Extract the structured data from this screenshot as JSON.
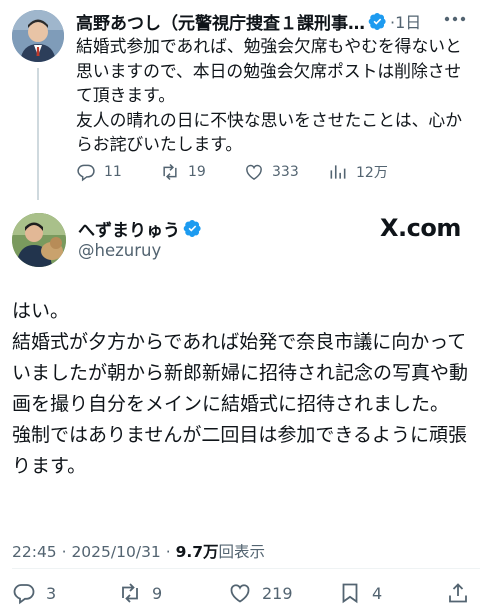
{
  "parent_tweet": {
    "name": "高野あつし（元警視庁捜査１課刑事…",
    "time": "·1日",
    "paragraphs": [
      "結婚式参加であれば、勉強会欠席もやむを得ないと思いますので、本日の勉強会欠席ポストは削除させて頂きます。",
      "友人の晴れの日に不快な思いをさせたことは、心からお詫びいたします。"
    ],
    "actions": {
      "replies": "11",
      "reposts": "19",
      "likes": "333",
      "views": "12万"
    }
  },
  "main_tweet": {
    "name": "へずまりゅう",
    "handle": "@hezuruy",
    "watermark": "X.com",
    "paragraphs": [
      "はい。",
      "結婚式が夕方からであれば始発で奈良市議に向かっていましたが朝から新郎新婦に招待され記念の写真や動画を撮り自分をメインに結婚式に招待されました。",
      "強制ではありませんが二回目は参加できるように頑張ります。"
    ],
    "timestamp": "22:45 · 2025/10/31 · ",
    "views_count": "9.7万",
    "views_label": "回表示",
    "actions": {
      "replies": "3",
      "reposts": "9",
      "likes": "219",
      "bookmarks": "4"
    }
  },
  "colors": {
    "verified": "#1d9bf0",
    "muted": "#536471",
    "text": "#0f1419"
  },
  "icons": [
    "reply-icon",
    "repost-icon",
    "like-icon",
    "views-icon",
    "bookmark-icon",
    "share-icon",
    "verified-badge-icon",
    "more-icon"
  ]
}
